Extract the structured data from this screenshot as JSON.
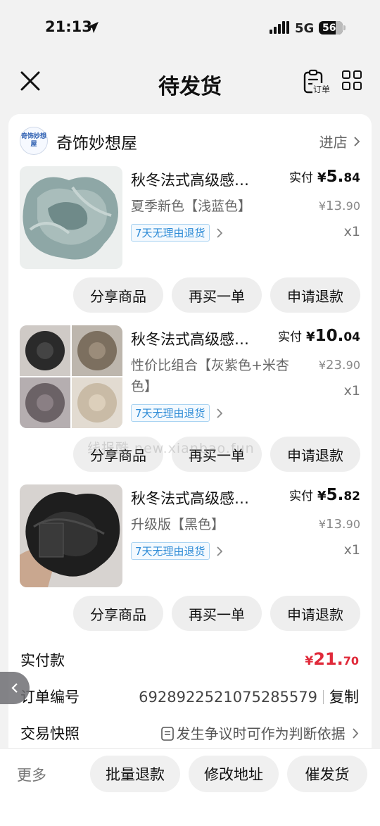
{
  "status_bar": {
    "time": "21:13",
    "network": "5G",
    "battery": "56"
  },
  "nav": {
    "title": "待发货",
    "order_icon_label": "订单"
  },
  "shop": {
    "logo_text": "奇饰妙想屋",
    "name": "奇饰妙想屋",
    "enter_label": "进店"
  },
  "products": [
    {
      "title": "秋冬法式高级感…",
      "paid_label": "实付",
      "paid_currency": "¥",
      "paid_int": "5.",
      "paid_dec": "84",
      "variant": "夏季新色【浅蓝色】",
      "orig_currency": "¥",
      "orig_int": "13.",
      "orig_dec": "90",
      "return_tag": "7天无理由退货",
      "qty": "x1",
      "actions": [
        "分享商品",
        "再买一单",
        "申请退款"
      ]
    },
    {
      "title": "秋冬法式高级感…",
      "paid_label": "实付",
      "paid_currency": "¥",
      "paid_int": "10.",
      "paid_dec": "04",
      "variant": "性价比组合【灰紫色+米杏色】",
      "orig_currency": "¥",
      "orig_int": "23.",
      "orig_dec": "90",
      "return_tag": "7天无理由退货",
      "qty": "x1",
      "actions": [
        "分享商品",
        "再买一单",
        "申请退款"
      ]
    },
    {
      "title": "秋冬法式高级感…",
      "paid_label": "实付",
      "paid_currency": "¥",
      "paid_int": "5.",
      "paid_dec": "82",
      "variant": "升级版【黑色】",
      "orig_currency": "¥",
      "orig_int": "13.",
      "orig_dec": "90",
      "return_tag": "7天无理由退货",
      "qty": "x1",
      "actions": [
        "分享商品",
        "再买一单",
        "申请退款"
      ]
    }
  ],
  "summary": {
    "total_label": "实付款",
    "total_currency": "¥",
    "total_int": "21.",
    "total_dec": "70",
    "order_no_label": "订单编号",
    "order_no": "6928922521075285579",
    "copy_label": "复制",
    "snapshot_label": "交易快照",
    "snapshot_text": "发生争议时可作为判断依据"
  },
  "watermark": "线报酷 new.xianbao.fun",
  "bottom_bar": {
    "more": "更多",
    "buttons": [
      "批量退款",
      "修改地址",
      "催发货"
    ]
  },
  "colors": {
    "price_red": "#e02a3a",
    "tag_blue": "#2b8ad6",
    "background": "#f2f2f2"
  }
}
